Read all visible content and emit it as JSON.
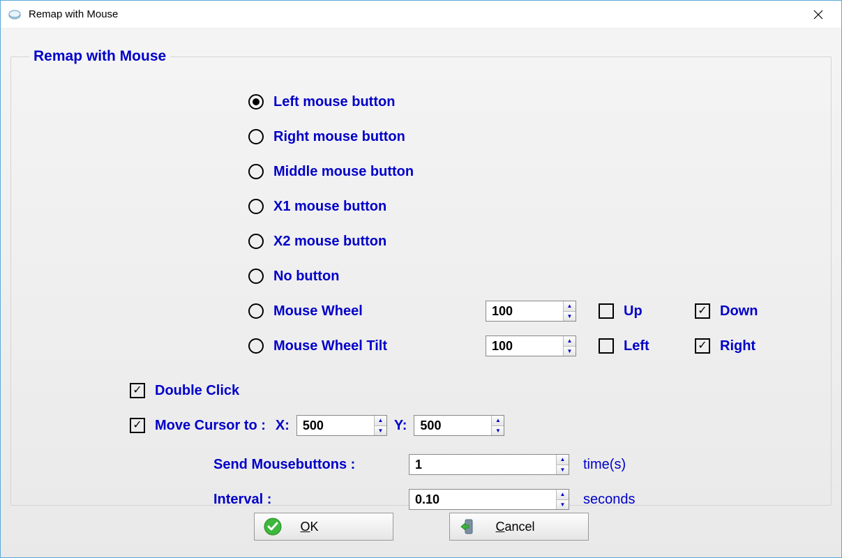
{
  "window": {
    "title": "Remap with Mouse"
  },
  "group": {
    "legend": "Remap with Mouse"
  },
  "radios": {
    "left": {
      "label": "Left mouse button",
      "selected": true
    },
    "right": {
      "label": "Right mouse button",
      "selected": false
    },
    "middle": {
      "label": "Middle mouse button",
      "selected": false
    },
    "x1": {
      "label": "X1 mouse button",
      "selected": false
    },
    "x2": {
      "label": "X2 mouse button",
      "selected": false
    },
    "none": {
      "label": "No button",
      "selected": false
    },
    "wheel": {
      "label": "Mouse Wheel",
      "selected": false,
      "value": "100",
      "cb_a": {
        "label": "Up",
        "checked": false
      },
      "cb_b": {
        "label": "Down",
        "checked": true
      }
    },
    "tilt": {
      "label": "Mouse Wheel Tilt",
      "selected": false,
      "value": "100",
      "cb_a": {
        "label": "Left",
        "checked": false
      },
      "cb_b": {
        "label": "Right",
        "checked": true
      }
    }
  },
  "double_click": {
    "label": "Double Click",
    "checked": true
  },
  "move_cursor": {
    "label": "Move Cursor to :",
    "checked": true,
    "x_label": "X:",
    "x_value": "500",
    "y_label": "Y:",
    "y_value": "500"
  },
  "send_mb": {
    "label": "Send Mousebuttons :",
    "value": "1",
    "unit": "time(s)"
  },
  "interval": {
    "label": "Interval  :",
    "value": "0.10",
    "unit": "seconds"
  },
  "buttons": {
    "ok": "OK",
    "cancel": "Cancel"
  }
}
